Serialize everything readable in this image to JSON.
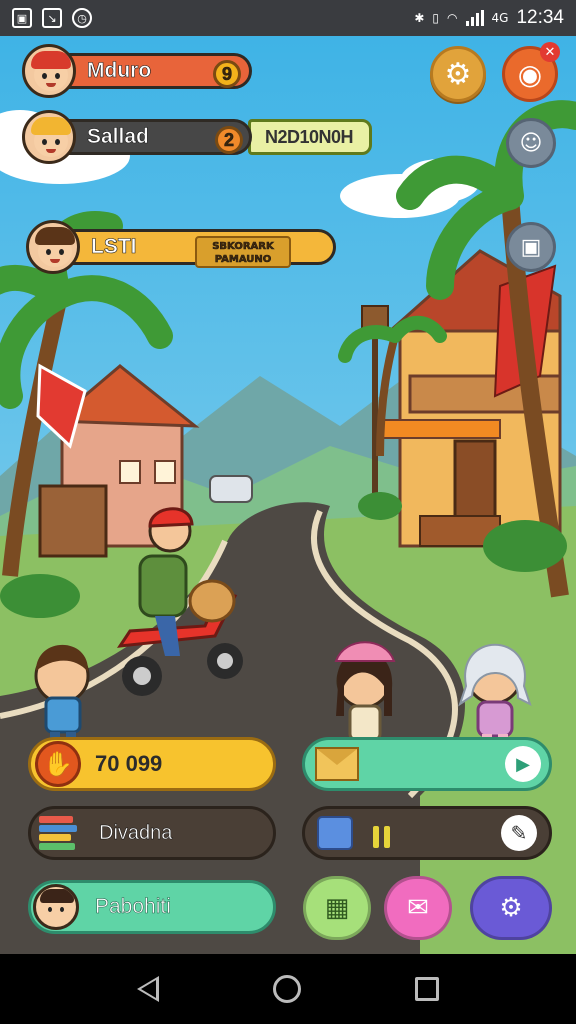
{
  "status_bar": {
    "left_icons": [
      "image-icon",
      "download-icon",
      "clock-icon"
    ],
    "right_icons": [
      "bluetooth-icon",
      "vibrate-icon",
      "wifi-icon",
      "signal-icon"
    ],
    "network": "4G",
    "time": "12:34"
  },
  "players": [
    {
      "name": "Mduro",
      "level": "9",
      "bar_color": "#e8643a"
    },
    {
      "name": "Sallad",
      "level": "2",
      "score": "N2D10N0H",
      "bar_color": "#474747"
    },
    {
      "name": "LSTI",
      "banner": "SBKORARK PAMAUNO",
      "bar_color": "#f4b73a"
    }
  ],
  "hud": {
    "coins": "70 099",
    "books_label": "Divadna",
    "profile_label": "Pabohiti"
  },
  "buttons": {
    "gear_top": "⚙",
    "target": "◉",
    "close": "✕",
    "side_1": "☺",
    "side_2": "▣",
    "play": "▶",
    "tools": "✎",
    "calendar": "▦",
    "gift": "✉",
    "gear_bottom": "⚙"
  },
  "colors": {
    "sky": "#5bc2ea",
    "road": "#4e4944",
    "grass": "#8cc063",
    "accent_orange": "#e8643a",
    "accent_teal": "#5fd4a6"
  }
}
